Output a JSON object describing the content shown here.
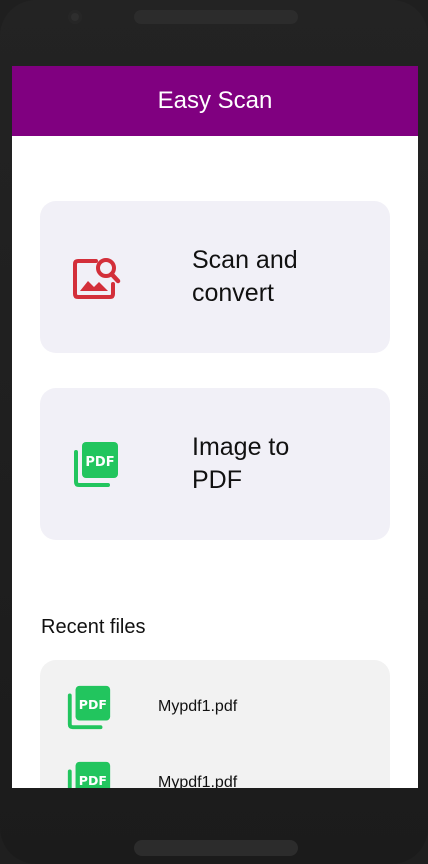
{
  "app": {
    "title": "Easy Scan"
  },
  "actions": [
    {
      "label": "Scan and\nconvert",
      "icon": "image-search-icon",
      "color": "#d32f3a"
    },
    {
      "label": "Image to\nPDF",
      "icon": "pdf-icon",
      "color": "#22c55e"
    }
  ],
  "recent": {
    "title": "Recent files",
    "files": [
      {
        "name": "Mypdf1.pdf",
        "icon": "pdf-icon"
      },
      {
        "name": "Mypdf1.pdf",
        "icon": "pdf-icon"
      }
    ]
  },
  "colors": {
    "appbar": "#800080",
    "card_bg": "#f1f0f7",
    "scan_icon": "#d32f3a",
    "pdf_icon": "#22c55e"
  }
}
